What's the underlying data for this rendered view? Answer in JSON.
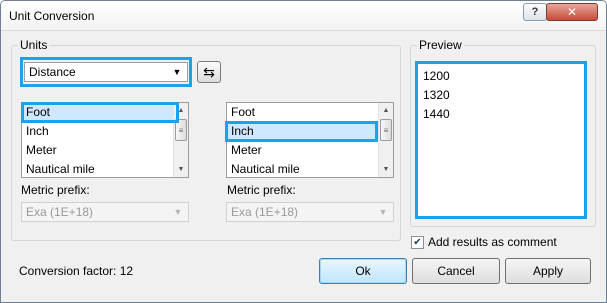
{
  "window": {
    "title": "Unit Conversion",
    "help_label": "?",
    "close_label": "✕"
  },
  "units": {
    "group_label": "Units",
    "category_selected": "Distance",
    "from_list": [
      "Foot",
      "Inch",
      "Meter",
      "Nautical mile"
    ],
    "from_selected": "Foot",
    "to_list": [
      "Foot",
      "Inch",
      "Meter",
      "Nautical mile"
    ],
    "to_selected": "Inch",
    "metric_prefix_label": "Metric prefix:",
    "from_prefix": "Exa (1E+18)",
    "to_prefix": "Exa (1E+18)",
    "swap_icon": "swap-arrows-icon"
  },
  "preview": {
    "group_label": "Preview",
    "lines": [
      "1200",
      "1320",
      "1440"
    ]
  },
  "options": {
    "add_comment_label": "Add results as comment",
    "add_comment_checked": true
  },
  "footer": {
    "conversion_factor": "Conversion factor: 12",
    "ok_label": "Ok",
    "cancel_label": "Cancel",
    "apply_label": "Apply"
  },
  "colors": {
    "highlight": "#1aa3e8",
    "selection": "#cde8ff"
  }
}
